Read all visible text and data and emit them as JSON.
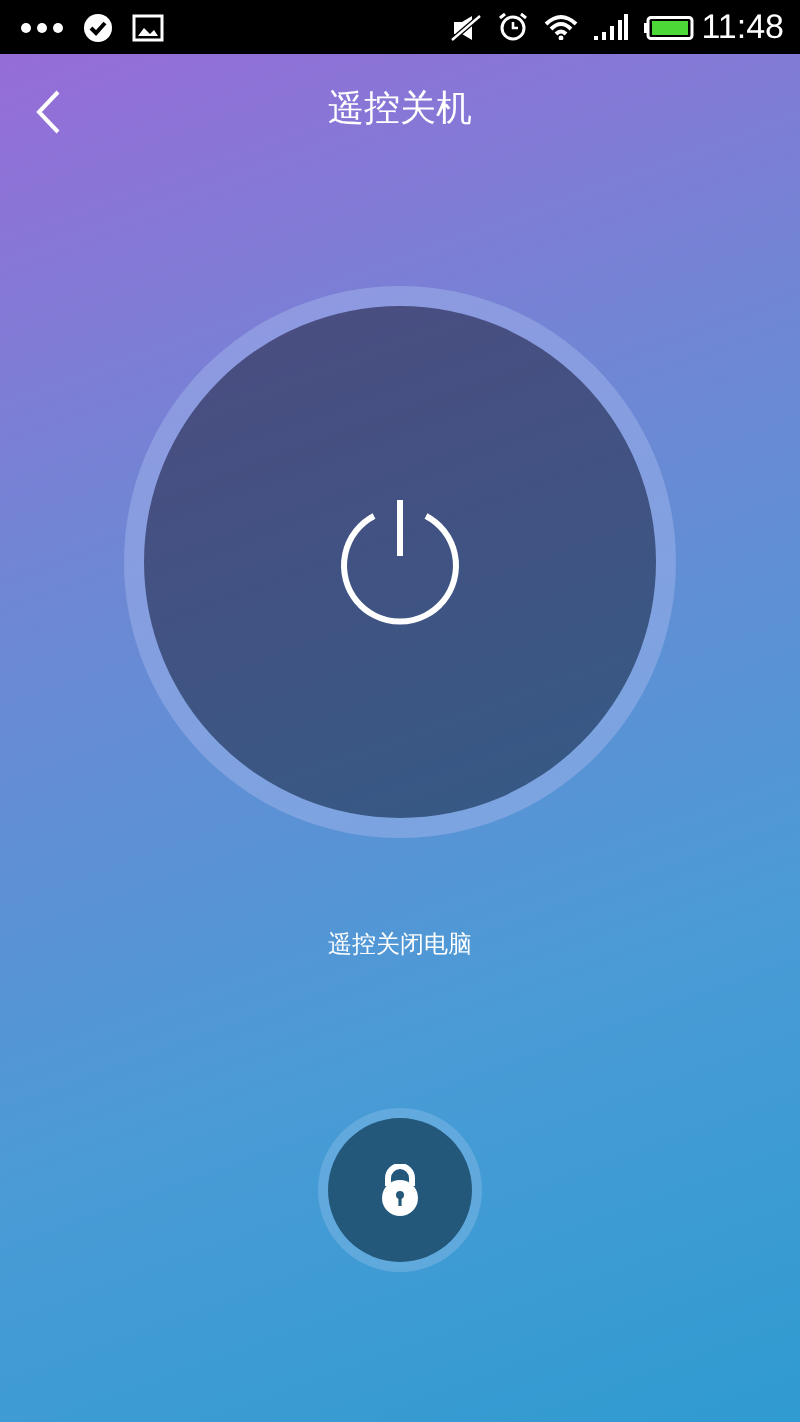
{
  "status_bar": {
    "time": "11:48"
  },
  "header": {
    "title": "遥控关机"
  },
  "power": {
    "caption": "遥控关闭电脑"
  }
}
